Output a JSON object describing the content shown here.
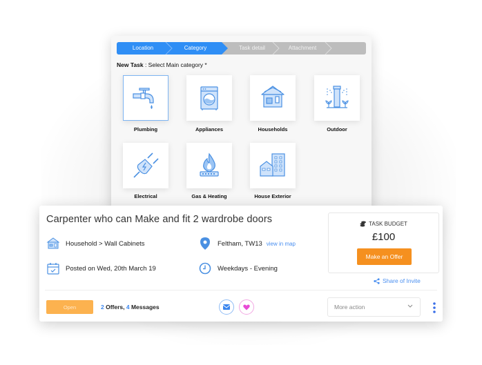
{
  "wizard": {
    "steps": [
      {
        "label": "Location",
        "state": "complete"
      },
      {
        "label": "Category",
        "state": "active"
      },
      {
        "label": "Task detail",
        "state": "pending"
      },
      {
        "label": "Attachment",
        "state": "pending"
      }
    ],
    "prompt_bold": "New Task",
    "prompt_rest": " : Select Main category *",
    "categories": [
      {
        "label": "Plumbing",
        "icon": "faucet-icon",
        "selected": true
      },
      {
        "label": "Appliances",
        "icon": "washing-machine-icon",
        "selected": false
      },
      {
        "label": "Households",
        "icon": "house-icon",
        "selected": false
      },
      {
        "label": "Outdoor",
        "icon": "sprinkler-icon",
        "selected": false
      },
      {
        "label": "Electrical",
        "icon": "plug-icon",
        "selected": false
      },
      {
        "label": "Gas & Heating",
        "icon": "gas-flame-icon",
        "selected": false
      },
      {
        "label": "House Exterior",
        "icon": "buildings-icon",
        "selected": false
      }
    ]
  },
  "task": {
    "title": "Carpenter who can Make and fit 2 wardrobe doors",
    "category_path": "Household > Wall Cabinets",
    "location": "Feltham, TW13",
    "view_map_link": "view in map",
    "posted": "Posted on Wed, 20th March 19",
    "schedule": "Weekdays - Evening",
    "budget_label": "TASK BUDGET",
    "budget_amount": "£100",
    "offer_button": "Make an Offer",
    "share_link": "Share of Invite",
    "status_button": "Open",
    "offers_count": "2",
    "offers_label": " Offers, ",
    "messages_count": "4",
    "messages_label": " Messages",
    "more_action_placeholder": "More action"
  },
  "colors": {
    "primary_blue": "#2f8ef5",
    "icon_blue": "#4a90e2",
    "icon_fill": "#cfe3fb",
    "orange": "#f5901f",
    "open_orange": "#fcb24f",
    "step_inactive": "#bdbdbd",
    "heart_pink": "#e84bd6"
  }
}
